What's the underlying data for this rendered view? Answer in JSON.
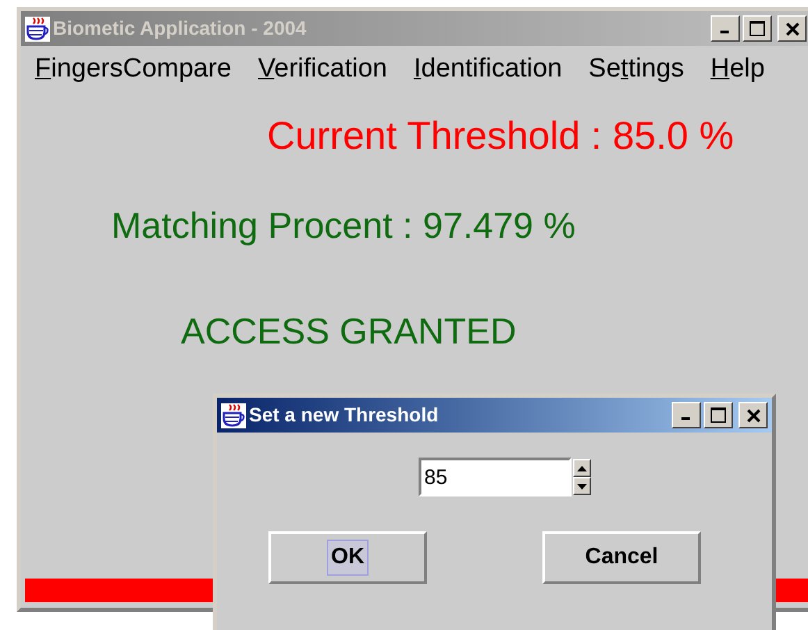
{
  "main_window": {
    "title": "Biometic Application - 2004",
    "active": false,
    "menu": [
      {
        "mnemonic": "F",
        "after": "ingersCompare"
      },
      {
        "mnemonic": "V",
        "after": "erification"
      },
      {
        "mnemonic": "I",
        "after": "dentification"
      },
      {
        "before": "Se",
        "mnemonic": "t",
        "after": "tings"
      },
      {
        "mnemonic": "H",
        "after": "elp"
      }
    ],
    "threshold_text": "Current Threshold : 85.0 %",
    "matching_text": "Matching Procent : 97.479 %",
    "status_text": "ACCESS GRANTED"
  },
  "dialog": {
    "title": "Set a new Threshold",
    "active": true,
    "spinner_value": "85",
    "buttons": [
      {
        "label": "OK",
        "focused": true
      },
      {
        "label": "Cancel",
        "focused": false
      }
    ]
  }
}
